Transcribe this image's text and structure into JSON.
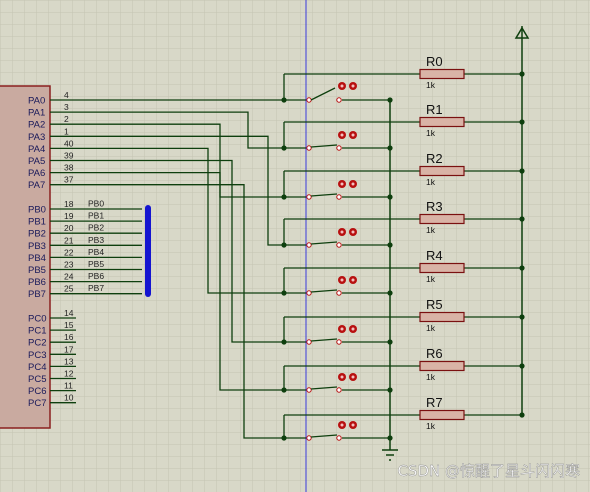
{
  "chip": {
    "port_a": [
      {
        "label": "PA0",
        "pin": "4"
      },
      {
        "label": "PA1",
        "pin": "3"
      },
      {
        "label": "PA2",
        "pin": "2"
      },
      {
        "label": "PA3",
        "pin": "1"
      },
      {
        "label": "PA4",
        "pin": "40"
      },
      {
        "label": "PA5",
        "pin": "39"
      },
      {
        "label": "PA6",
        "pin": "38"
      },
      {
        "label": "PA7",
        "pin": "37"
      }
    ],
    "port_b": [
      {
        "label": "PB0",
        "pin": "18",
        "net": "PB0"
      },
      {
        "label": "PB1",
        "pin": "19",
        "net": "PB1"
      },
      {
        "label": "PB2",
        "pin": "20",
        "net": "PB2"
      },
      {
        "label": "PB3",
        "pin": "21",
        "net": "PB3"
      },
      {
        "label": "PB4",
        "pin": "22",
        "net": "PB4"
      },
      {
        "label": "PB5",
        "pin": "23",
        "net": "PB5"
      },
      {
        "label": "PB6",
        "pin": "24",
        "net": "PB6"
      },
      {
        "label": "PB7",
        "pin": "25",
        "net": "PB7"
      }
    ],
    "port_c": [
      {
        "label": "PC0",
        "pin": "14"
      },
      {
        "label": "PC1",
        "pin": "15"
      },
      {
        "label": "PC2",
        "pin": "16"
      },
      {
        "label": "PC3",
        "pin": "17"
      },
      {
        "label": "PC4",
        "pin": "13"
      },
      {
        "label": "PC5",
        "pin": "12"
      },
      {
        "label": "PC6",
        "pin": "11"
      },
      {
        "label": "PC7",
        "pin": "10"
      }
    ]
  },
  "resistors": [
    {
      "name": "R0",
      "value": "1k"
    },
    {
      "name": "R1",
      "value": "1k"
    },
    {
      "name": "R2",
      "value": "1k"
    },
    {
      "name": "R3",
      "value": "1k"
    },
    {
      "name": "R4",
      "value": "1k"
    },
    {
      "name": "R5",
      "value": "1k"
    },
    {
      "name": "R6",
      "value": "1k"
    },
    {
      "name": "R7",
      "value": "1k"
    }
  ],
  "watermark": "CSDN @惊醒了星斗闪闪寒",
  "colors": {
    "background": "#d8d8c8",
    "grid": "#c4c4b2",
    "wire": "#0e3f0e",
    "chip_fill": "#c9aaa0",
    "chip_border": "#8b1f1f",
    "pin_text": "#1a1a5a",
    "resistor_fill": "#d9b3a6",
    "resistor_border": "#7a1010",
    "switch_red": "#b81010",
    "bus": "#1414d0",
    "axis_line": "#3a3adc"
  }
}
